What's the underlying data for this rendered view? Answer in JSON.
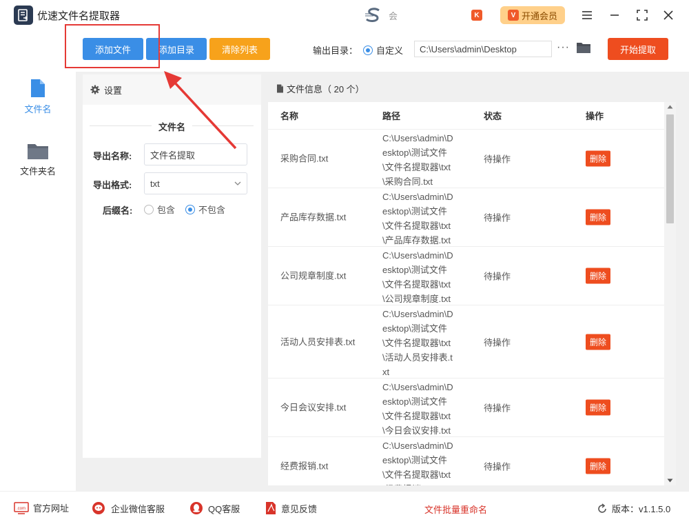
{
  "app": {
    "title": "优速文件名提取器",
    "brand_text": "会",
    "vip_label": "开通会员",
    "vip_badge": "V",
    "k_badge": "K"
  },
  "colors": {
    "primary": "#3a8ee6",
    "warning": "#f7a21b",
    "danger": "#ee4d1f",
    "vip_bg": "#ffd08a"
  },
  "nav": [
    {
      "label": "文件名",
      "icon": "file-icon",
      "active": true
    },
    {
      "label": "文件夹名",
      "icon": "folder-icon",
      "active": false
    }
  ],
  "toolbar": {
    "add_file": "添加文件",
    "add_dir": "添加目录",
    "clear_list": "清除列表",
    "output_label": "输出目录：",
    "output_option": "自定义",
    "output_path": "C:\\Users\\admin\\Desktop",
    "start": "开始提取"
  },
  "settings": {
    "header": "设置",
    "section_title": "文件名",
    "export_name_label": "导出名称:",
    "export_name_value": "文件名提取",
    "export_format_label": "导出格式:",
    "export_format_value": "txt",
    "suffix_label": "后缀名:",
    "suffix_include": "包含",
    "suffix_exclude": "不包含",
    "suffix_selected": "不包含"
  },
  "file_info": {
    "header": "文件信息（ 20 个）",
    "columns": [
      "名称",
      "路径",
      "状态",
      "操作"
    ],
    "rows": [
      {
        "name": "采购合同.txt",
        "path_lines": [
          "C:\\Users\\admin\\D",
          "esktop\\测试文件",
          "\\文件名提取器\\txt",
          "\\采购合同.txt"
        ],
        "status": "待操作",
        "action": "删除"
      },
      {
        "name": "产品库存数据.txt",
        "path_lines": [
          "C:\\Users\\admin\\D",
          "esktop\\测试文件",
          "\\文件名提取器\\txt",
          "\\产品库存数据.txt"
        ],
        "status": "待操作",
        "action": "删除"
      },
      {
        "name": "公司规章制度.txt",
        "path_lines": [
          "C:\\Users\\admin\\D",
          "esktop\\测试文件",
          "\\文件名提取器\\txt",
          "\\公司规章制度.txt"
        ],
        "status": "待操作",
        "action": "删除"
      },
      {
        "name": "活动人员安排表.txt",
        "path_lines": [
          "C:\\Users\\admin\\D",
          "esktop\\测试文件",
          "\\文件名提取器\\txt",
          "\\活动人员安排表.t",
          "xt"
        ],
        "status": "待操作",
        "action": "删除"
      },
      {
        "name": "今日会议安排.txt",
        "path_lines": [
          "C:\\Users\\admin\\D",
          "esktop\\测试文件",
          "\\文件名提取器\\txt",
          "\\今日会议安排.txt"
        ],
        "status": "待操作",
        "action": "删除"
      },
      {
        "name": "经费报销.txt",
        "path_lines": [
          "C:\\Users\\admin\\D",
          "esktop\\测试文件",
          "\\文件名提取器\\txt",
          "\\经费报销.txt"
        ],
        "status": "待操作",
        "action": "删除"
      }
    ]
  },
  "footer": {
    "website": "官方网址",
    "wechat": "企业微信客服",
    "qq": "QQ客服",
    "feedback": "意见反馈",
    "rename": "文件批量重命名",
    "version": "版本：v1.1.5.0"
  }
}
